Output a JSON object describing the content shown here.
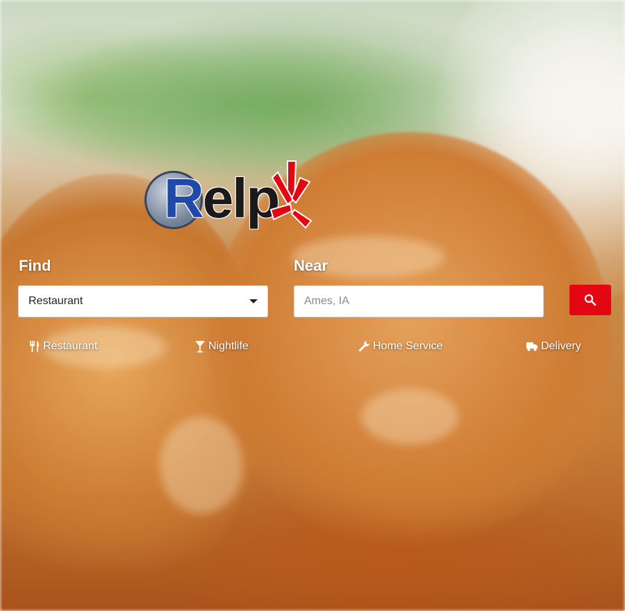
{
  "brand": {
    "logo_text": "Relp",
    "accent_color": "#e30613",
    "logo_blue": "#1f4aa8"
  },
  "search": {
    "find_label": "Find",
    "near_label": "Near",
    "find_value": "Restaurant",
    "near_placeholder": "Ames, IA",
    "search_icon": "search-icon"
  },
  "categories": [
    {
      "label": "Restaurant",
      "icon": "fork-knife-icon"
    },
    {
      "label": "Nightlife",
      "icon": "cocktail-icon"
    },
    {
      "label": "Home Service",
      "icon": "wrench-icon"
    },
    {
      "label": "Delivery",
      "icon": "delivery-icon"
    }
  ]
}
